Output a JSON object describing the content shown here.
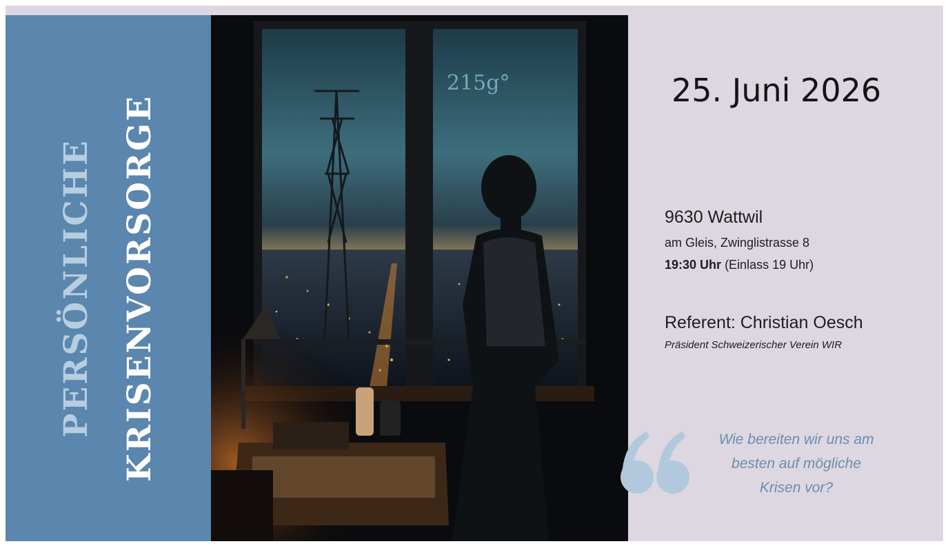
{
  "title": {
    "line1": "PERSÖNLICHE",
    "line2": "KRISENVORSORGE"
  },
  "photo": {
    "overlay_text": "215g°"
  },
  "event": {
    "date": "25. Juni 2026",
    "city": "9630 Wattwil",
    "street": "am Gleis, Zwinglistrasse 8",
    "time_bold": "19:30 Uhr",
    "time_note": "(Einlass 19 Uhr)"
  },
  "speaker": {
    "label": "Referent: Christian Oesch",
    "role": "Präsident Schweizerischer Verein WIR"
  },
  "quote": {
    "icon": "quote-marks-icon",
    "lines": [
      "Wie bereiten wir uns am",
      "besten auf mögliche",
      "Krisen vor?"
    ]
  },
  "colors": {
    "sidebar": "#5b86ad",
    "background": "#dcd7e0",
    "title_light": "#b7cde0",
    "title_white": "#ffffff",
    "quote": "#6c8dae"
  }
}
